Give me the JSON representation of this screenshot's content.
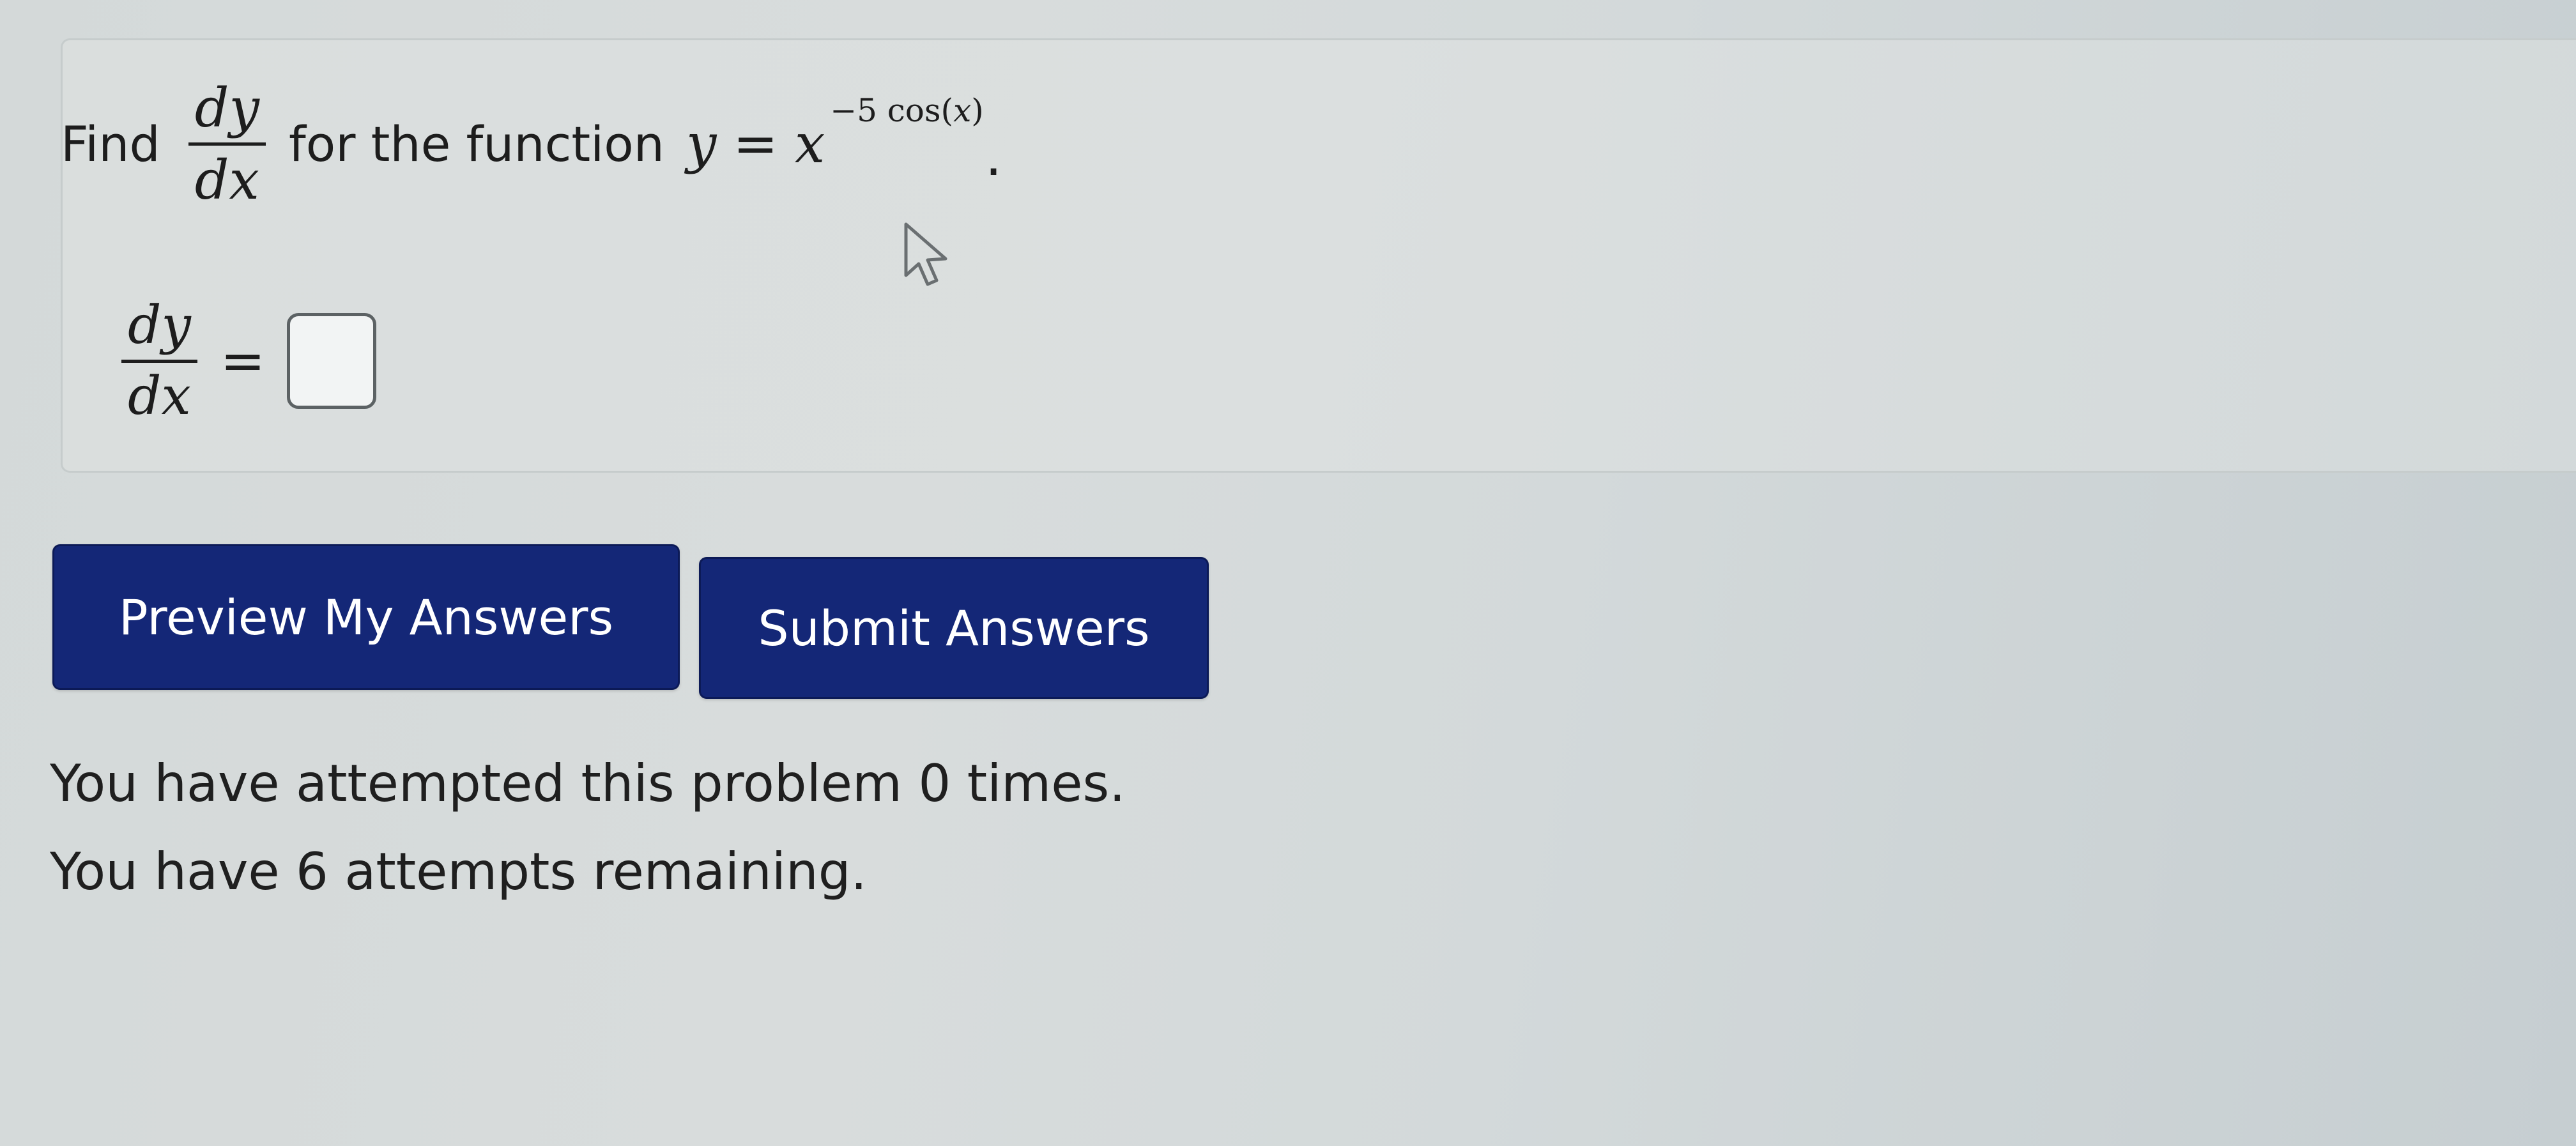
{
  "problem": {
    "find_label": "Find",
    "derivative_num": "dy",
    "derivative_den": "dx",
    "for_text": "for the function",
    "function_lhs": "y",
    "equals_sign": "=",
    "function_base": "x",
    "exponent_coeff": "−5 cos(",
    "exponent_var": "x",
    "exponent_close": ")",
    "period": "."
  },
  "answer": {
    "derivative_num": "dy",
    "derivative_den": "dx",
    "equals_sign": "=",
    "input_value": ""
  },
  "buttons": {
    "preview_label": "Preview My Answers",
    "submit_label": "Submit Answers"
  },
  "status": {
    "attempted_text": "You have attempted this problem 0 times.",
    "remaining_text": "You have 6 attempts remaining."
  },
  "colors": {
    "button_bg": "#142777",
    "button_text": "#ffffff",
    "background": "#d6dbdb"
  },
  "icons": {
    "cursor": "mouse-pointer-icon"
  }
}
